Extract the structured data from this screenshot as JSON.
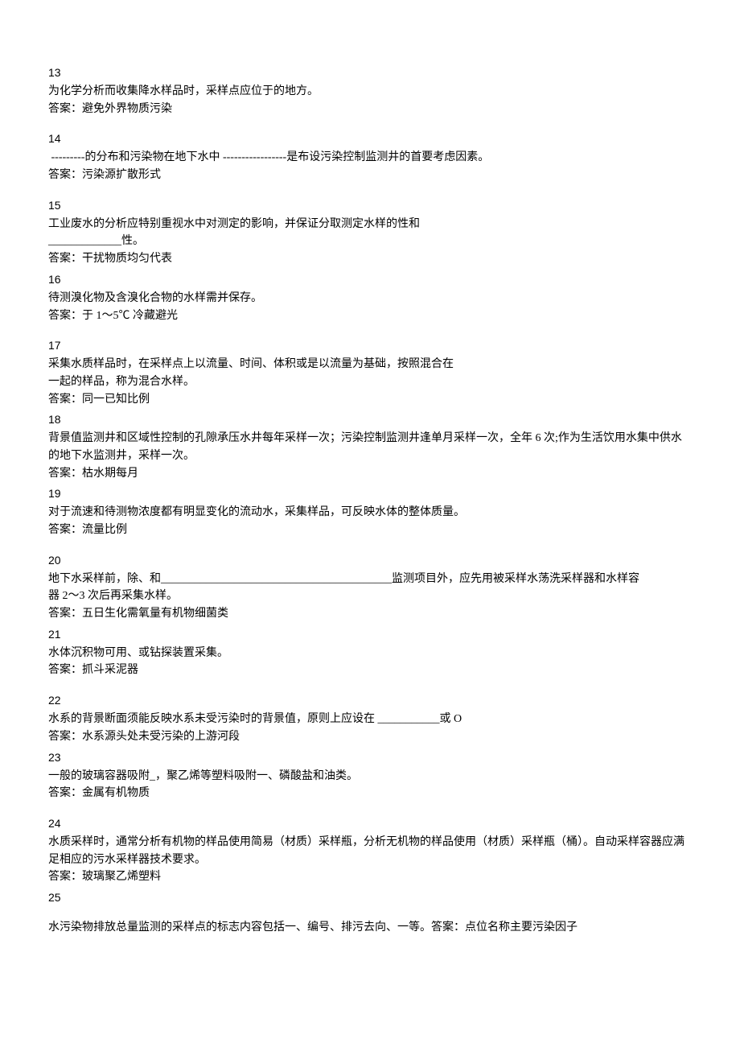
{
  "items": [
    {
      "num": "13",
      "q": "为化学分析而收集降水样品时，采样点应位于的地方。",
      "a": "答案：避免外界物质污染"
    },
    {
      "num": "14",
      "q": " ---------的分布和污染物在地下水中 -----------------是布设污染控制监测井的首要考虑因素。",
      "a": "答案：污染源扩散形式"
    },
    {
      "num": "15",
      "q": "工业废水的分析应特别重视水中对测定的影响，并保证分取测定水样的性和\n_____________性。",
      "a": "答案：干扰物质均匀代表",
      "tight": true
    },
    {
      "num": "16",
      "q": "待测溴化物及含溴化合物的水样需并保存。",
      "a": "答案：于 1～5℃ 冷藏避光"
    },
    {
      "num": "17",
      "q": "采集水质样品时，在采样点上以流量、时间、体积或是以流量为基础，按照混合在\n一起的样品，称为混合水样。",
      "a": "答案：同一已知比例",
      "tight": true
    },
    {
      "num": "18",
      "q": "背景值监测井和区域性控制的孔隙承压水井每年采样一次；污染控制监测井逢单月采样一次，全年 6 次;作为生活饮用水集中供水的地下水监测井，采样一次。",
      "a": "答案：枯水期每月",
      "tight": true
    },
    {
      "num": "19",
      "q": "对于流速和待测物浓度都有明显变化的流动水，采集样品，可反映水体的整体质量。",
      "a": "答案：流量比例"
    },
    {
      "num": "20",
      "q": "地下水采样前，除、和_________________________________________监测项目外，应先用被采样水荡洗采样器和水样容\n器 2～3 次后再采集水样。",
      "a": "答案：五日生化需氧量有机物细菌类",
      "tight": true
    },
    {
      "num": "21",
      "q": "水体沉积物可用、或钻探装置采集。",
      "a": "答案：抓斗采泥器"
    },
    {
      "num": "22",
      "q": "水系的背景断面须能反映水系未受污染时的背景值，原则上应设在 ___________或 O",
      "a": "答案：水系源头处未受污染的上游河段",
      "tight": true
    },
    {
      "num": "23",
      "q": "一般的玻璃容器吸附_，聚乙烯等塑料吸附一、磷酸盐和油类。",
      "a": "答案：金属有机物质"
    },
    {
      "num": "24",
      "q": "水质采样时，通常分析有机物的样品使用简易（材质）采样瓶，分析无机物的样品使用（材质）采样瓶（桶）。自动采样容器应满足相应的污水采样器技术要求。",
      "a": "答案：玻璃聚乙烯塑料",
      "tight": true
    },
    {
      "num": "25",
      "q": "水污染物排放总量监测的采样点的标志内容包括一、编号、排污去向、一等。答案：点位名称主要污染因子",
      "a": "",
      "gap": true
    }
  ]
}
